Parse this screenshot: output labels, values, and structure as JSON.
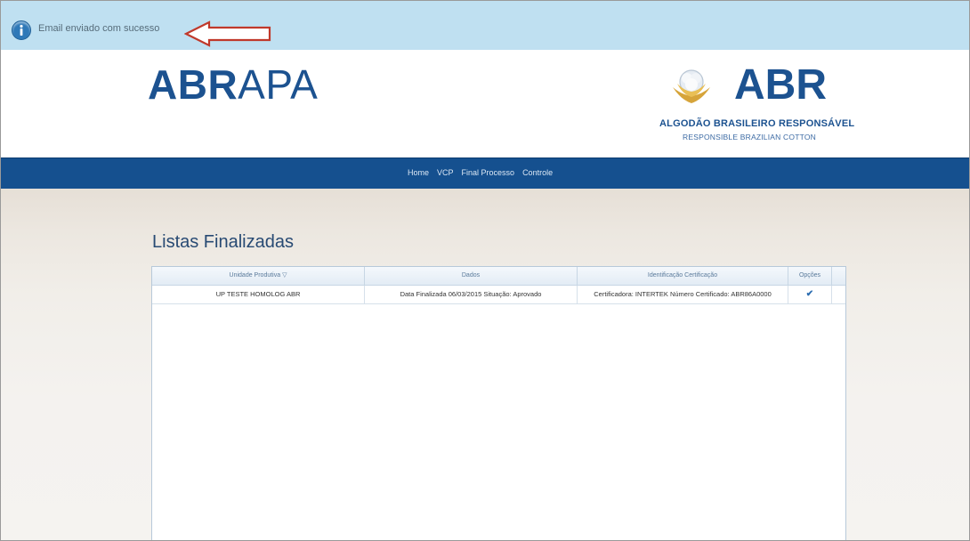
{
  "notification": {
    "message": "Email enviado com sucesso",
    "icon": "info-icon",
    "arrow_icon": "arrow-left-icon",
    "arrow_color": "#c0392b"
  },
  "header": {
    "logo_left_bold": "ABR",
    "logo_left_light": "APA",
    "logo_right": "ABR",
    "logo_right_line1": "ALGODÃO BRASILEIRO RESPONSÁVEL",
    "logo_right_line2": "RESPONSIBLE BRAZILIAN COTTON",
    "brand_color": "#1c5290"
  },
  "nav": {
    "items": [
      "Home",
      "VCP",
      "Final Processo",
      "Controle"
    ],
    "background": "#15508f"
  },
  "main": {
    "title": "Listas Finalizadas",
    "table": {
      "columns": [
        "Unidade Produtiva ▽",
        "Dados",
        "Identificação Certificação",
        "Opções"
      ],
      "rows": [
        {
          "unidade": "UP TESTE HOMOLOG ABR",
          "dados": "Data Finalizada 06/03/2015 Situação: Aprovado",
          "certificacao": "Certificadora: INTERTEK Número Certificado: ABR86A0000",
          "opcoes_icon": "check-icon"
        }
      ]
    }
  }
}
